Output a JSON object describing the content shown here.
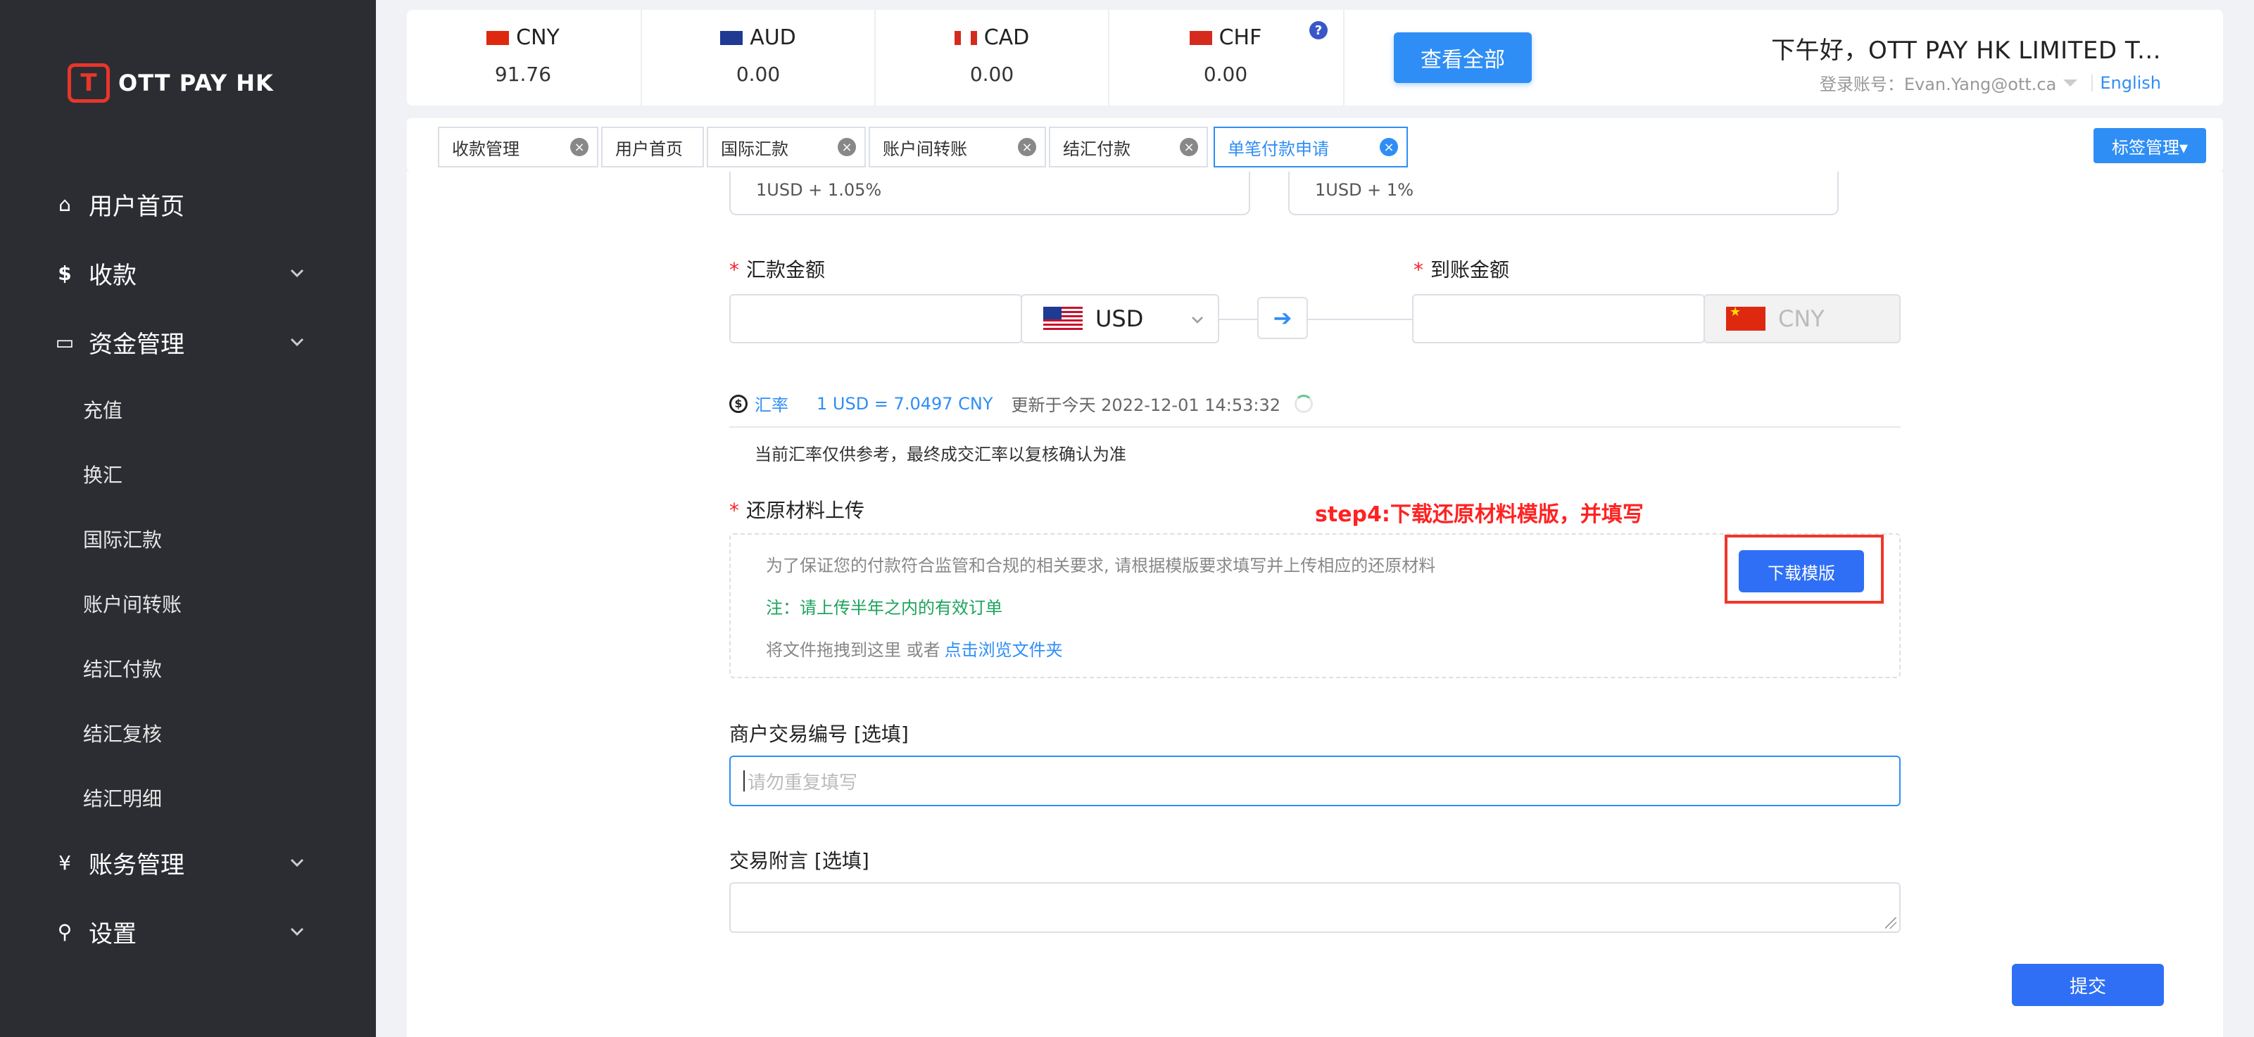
{
  "brand": {
    "logo_text": "OTT PAY HK"
  },
  "sidebar": {
    "items": [
      {
        "label": "用户首页",
        "icon": "home-icon",
        "glyph": "⌂",
        "has_children": false
      },
      {
        "label": "收款",
        "icon": "dollar-icon",
        "glyph": "$",
        "has_children": true
      },
      {
        "label": "资金管理",
        "icon": "card-icon",
        "glyph": "▭",
        "has_children": true
      },
      {
        "label": "账务管理",
        "icon": "yen-icon",
        "glyph": "¥",
        "has_children": true
      },
      {
        "label": "设置",
        "icon": "search-icon",
        "glyph": "⚲",
        "has_children": true
      }
    ],
    "sub_items": [
      "充值",
      "换汇",
      "国际汇款",
      "账户间转账",
      "结汇付款",
      "结汇复核",
      "结汇明细"
    ]
  },
  "header": {
    "currencies": [
      {
        "code": "CNY",
        "amount": "91.76"
      },
      {
        "code": "AUD",
        "amount": "0.00"
      },
      {
        "code": "CAD",
        "amount": "0.00"
      },
      {
        "code": "CHF",
        "amount": "0.00"
      }
    ],
    "help_glyph": "?",
    "view_all_label": "查看全部",
    "greeting": "下午好，OTT PAY HK LIMITED T...",
    "account_label": "登录账号：Evan.Yang@ott.ca",
    "language": "English"
  },
  "tabs": [
    {
      "label": "收款管理",
      "active": false
    },
    {
      "label": "用户首页",
      "active": false
    },
    {
      "label": "国际汇款",
      "active": false
    },
    {
      "label": "账户间转账",
      "active": false
    },
    {
      "label": "结汇付款",
      "active": false
    },
    {
      "label": "单笔付款申请",
      "active": true
    }
  ],
  "tag_manage_label": "标签管理▾",
  "form": {
    "fee_left": "1USD + 1.05%",
    "fee_right": "1USD + 1%",
    "remit_amount_label": "汇款金额",
    "receive_amount_label": "到账金额",
    "required_mark": "*",
    "send_currency": "USD",
    "receive_currency": "CNY",
    "arrow_glyph": "➔",
    "rate_label": "汇率",
    "rate_value": "1 USD = 7.0497 CNY",
    "rate_updated": "更新于今天 2022-12-01 14:53:32",
    "rate_note": "当前汇率仅供参考，最终成交汇率以复核确认为准",
    "upload_label": "还原材料上传",
    "step_note": "step4:下载还原材料模版，并填写",
    "upload_desc": "为了保证您的付款符合监管和合规的相关要求, 请根据模版要求填写并上传相应的还原材料",
    "upload_notice": "注：请上传半年之内的有效订单",
    "upload_drop": "将文件拖拽到这里 或者",
    "upload_browse": "点击浏览文件夹",
    "download_label": "下载模版",
    "merchant_ref_label": "商户交易编号 [选填]",
    "merchant_ref_placeholder": "请勿重复填写",
    "memo_label": "交易附言 [选填]",
    "submit_label": "提交"
  }
}
